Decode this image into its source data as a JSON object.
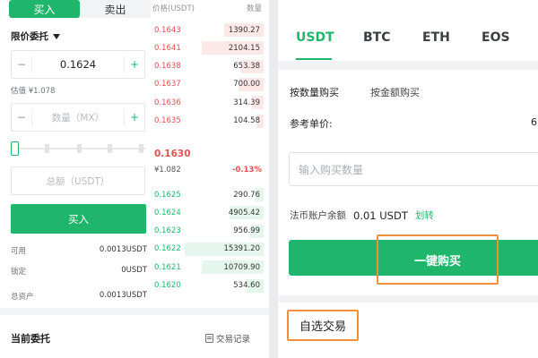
{
  "left": {
    "tabs": [
      "买入",
      "卖出"
    ],
    "order_type": "限价委托",
    "price_input": {
      "minus": "−",
      "value": "0.1624",
      "plus": "+"
    },
    "estimate": "估值 ¥1.078",
    "amount_input": {
      "minus": "−",
      "placeholder": "数量（MX）",
      "plus": "+"
    },
    "slider_percent": 0,
    "total_placeholder": "总额（USDT）",
    "buy_button": "买入",
    "balances": [
      {
        "label": "可用",
        "value": "0.0013USDT"
      },
      {
        "label": "锁定",
        "value": "0USDT"
      },
      {
        "label": "总资产",
        "value": "0.0013USDT"
      }
    ],
    "current_orders": "当前委托",
    "trade_records": "交易记录"
  },
  "orderbook": {
    "header": {
      "price": "价格(USDT)",
      "qty": "数量"
    },
    "asks": [
      {
        "price": "0.1643",
        "qty": "1390.27",
        "depth": 0.35
      },
      {
        "price": "0.1641",
        "qty": "2104.15",
        "depth": 0.55
      },
      {
        "price": "0.1638",
        "qty": "653.38",
        "depth": 0.2
      },
      {
        "price": "0.1637",
        "qty": "700.00",
        "depth": 0.22
      },
      {
        "price": "0.1636",
        "qty": "314.39",
        "depth": 0.1
      },
      {
        "price": "0.1635",
        "qty": "104.58",
        "depth": 0.06
      }
    ],
    "last_price": "0.1630",
    "last_cny": "¥1.082",
    "change": "-0.13%",
    "bids": [
      {
        "price": "0.1625",
        "qty": "290.76",
        "depth": 0.08
      },
      {
        "price": "0.1624",
        "qty": "4905.42",
        "depth": 0.3
      },
      {
        "price": "0.1623",
        "qty": "956.99",
        "depth": 0.12
      },
      {
        "price": "0.1622",
        "qty": "15391.20",
        "depth": 0.7
      },
      {
        "price": "0.1621",
        "qty": "10709.90",
        "depth": 0.55
      },
      {
        "price": "0.1620",
        "qty": "534.60",
        "depth": 0.15
      }
    ]
  },
  "right": {
    "coin_tabs": [
      "USDT",
      "BTC",
      "ETH",
      "EOS"
    ],
    "active_tab": "USDT",
    "modes": [
      "按数量购买",
      "按金额购买"
    ],
    "ref_label": "参考单价:",
    "ref_value": "6",
    "qty_placeholder": "输入购买数量",
    "fiat_label": "法币账户余额",
    "fiat_amount": "0.01 USDT",
    "transfer": "划转",
    "onekey_buy": "一键购买",
    "watchlist": "自选交易"
  },
  "colors": {
    "accent": "#1fb66b",
    "ask": "#e05050",
    "highlight": "#f0913a"
  }
}
